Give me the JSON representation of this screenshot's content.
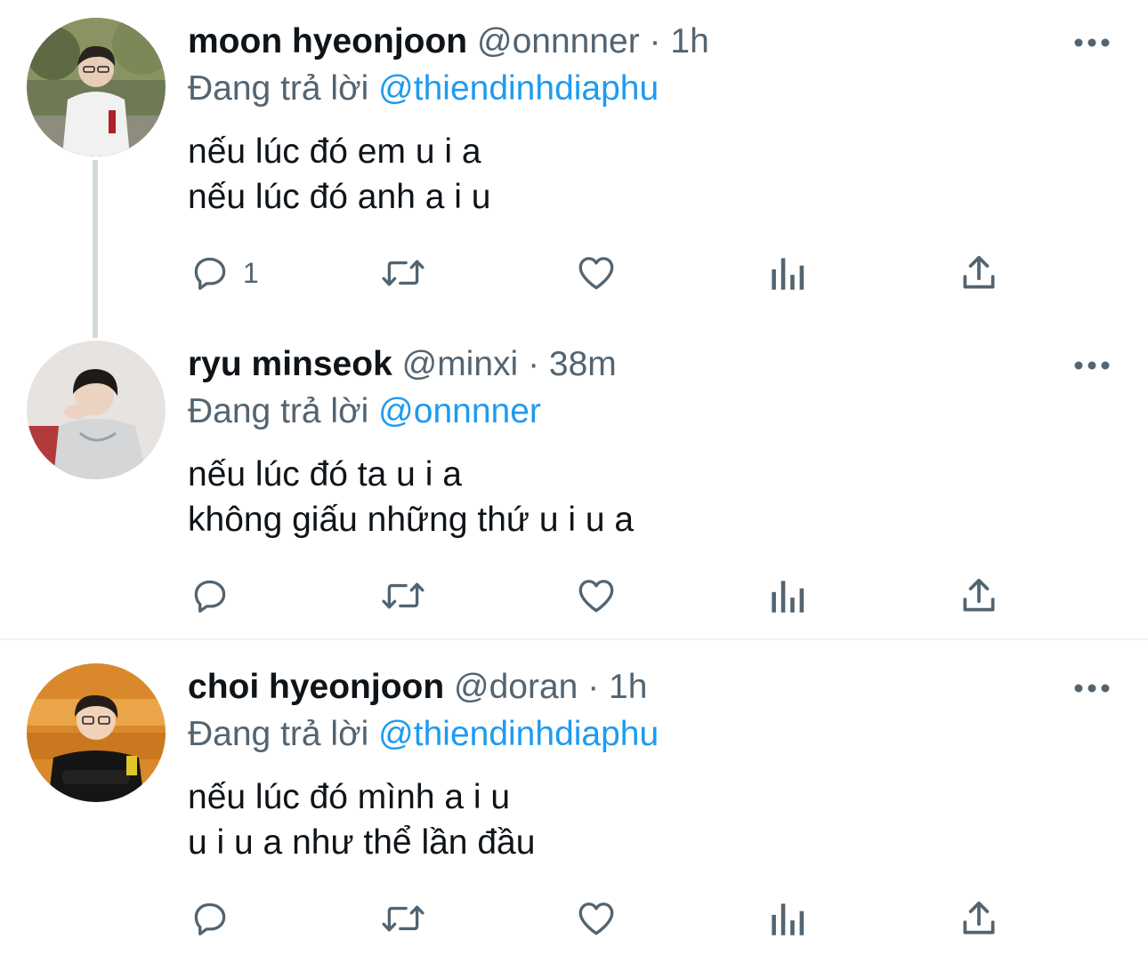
{
  "tweets": [
    {
      "name": "moon hyeonjoon",
      "handle": "@onnnner",
      "separator": "·",
      "time": "1h",
      "reply_prefix": "Đang trả lời",
      "reply_to": "@thiendinhdiaphu",
      "lines": [
        "nếu lúc đó em u i a",
        "nếu lúc đó anh a i u"
      ],
      "reply_count": "1"
    },
    {
      "name": "ryu minseok",
      "handle": "@minxi",
      "separator": "·",
      "time": "38m",
      "reply_prefix": "Đang trả lời",
      "reply_to": "@onnnner",
      "lines": [
        "nếu lúc đó ta u i a",
        "không giấu những thứ u i u a"
      ],
      "reply_count": ""
    },
    {
      "name": "choi hyeonjoon",
      "handle": "@doran",
      "separator": "·",
      "time": "1h",
      "reply_prefix": "Đang trả lời",
      "reply_to": "@thiendinhdiaphu",
      "lines": [
        "nếu lúc đó mình a i u",
        "u i u a như thể lần đầu"
      ],
      "reply_count": ""
    }
  ],
  "colors": {
    "text": "#0f1419",
    "secondary": "#536471",
    "accent": "#1d9bf0",
    "thread_line": "#cfd9de",
    "divider": "#eff3f4"
  },
  "icons": [
    "reply-icon",
    "retweet-icon",
    "like-icon",
    "analytics-icon",
    "share-icon",
    "more-icon"
  ]
}
